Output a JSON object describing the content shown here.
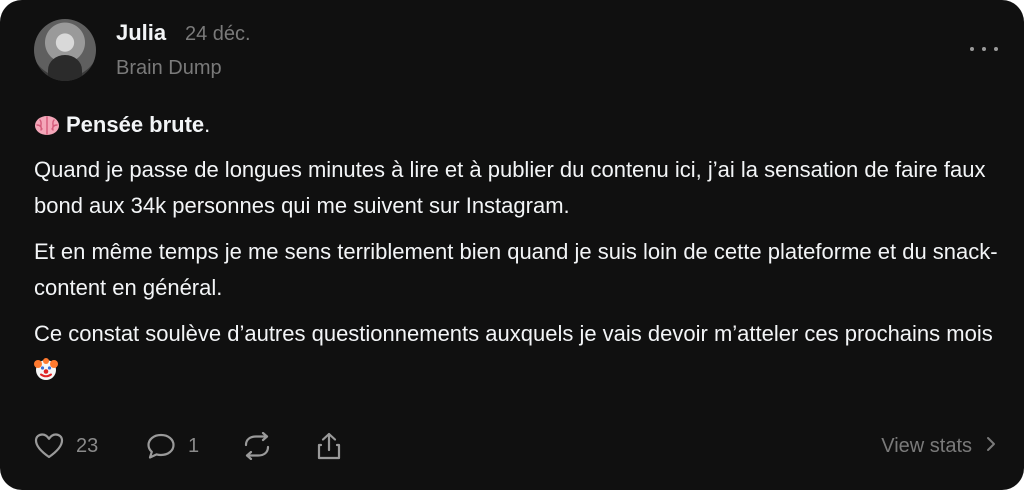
{
  "post": {
    "author": "Julia",
    "date": "24 déc.",
    "community": "Brain Dump",
    "heading_title": "Pensée brute",
    "heading_suffix": ".",
    "paragraphs": [
      "Quand je passe de longues minutes à lire et à publier du contenu ici, j’ai la sensation de faire faux bond aux 34k personnes qui me suivent sur Instagram.",
      "Et en même temps je me sens terriblement bien quand je suis loin de cette plateforme et du snack-content en général.",
      "Ce constat soulève d’autres questionnements auxquels je vais devoir m’atteler ces prochains mois"
    ],
    "icons": {
      "heading_emoji": "brain-emoji",
      "trailing_emoji": "clown-face-emoji"
    }
  },
  "actions": {
    "likes": "23",
    "replies": "1",
    "view_stats": "View stats"
  },
  "colors": {
    "background": "#101010",
    "text_primary": "#f3f5f7",
    "text_secondary": "#7a7a7a"
  }
}
